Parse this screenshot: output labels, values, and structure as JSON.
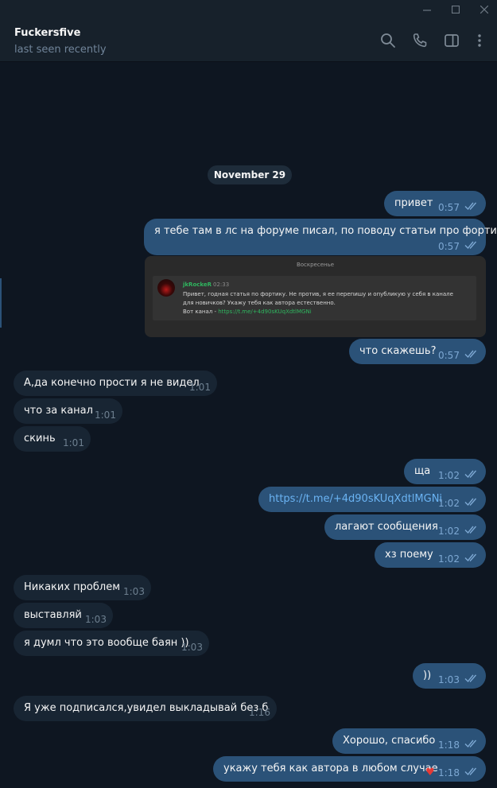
{
  "header": {
    "name": "Fuckersfive",
    "status": "last seen recently"
  },
  "date": "November 29",
  "screenshot": {
    "day": "Воскресенье",
    "author": "jkRockeR",
    "time": "02:33",
    "line1": "Привет, годная статья по фортику. Не против, я ее перепишу и опубликую у себя в канале",
    "line2": "для новичков? Укажу тебя как автора естественно.",
    "line3_prefix": "Вот канал - ",
    "line3_link": "https://t.me/+4d90sKUqXdtlMGNi"
  },
  "messages": [
    {
      "dir": "out",
      "text": "привет",
      "time": "0:57"
    },
    {
      "dir": "out",
      "text": "я тебе там в лс на форуме писал, по поводу статьи про фортик",
      "time": "0:57"
    },
    {
      "dir": "out",
      "text": "что скажешь?",
      "time": "0:57"
    },
    {
      "dir": "in",
      "text": "А,да конечно прости я не видел",
      "time": "1:01"
    },
    {
      "dir": "in",
      "text": "что за канал",
      "time": "1:01"
    },
    {
      "dir": "in",
      "text": "скинь",
      "time": "1:01"
    },
    {
      "dir": "out",
      "text": "ща",
      "time": "1:02"
    },
    {
      "dir": "out",
      "text": "https://t.me/+4d90sKUqXdtlMGNi",
      "time": "1:02"
    },
    {
      "dir": "out",
      "text": "лагают сообщения",
      "time": "1:02"
    },
    {
      "dir": "out",
      "text": "хз поему",
      "time": "1:02"
    },
    {
      "dir": "in",
      "text": "Никаких проблем",
      "time": "1:03"
    },
    {
      "dir": "in",
      "text": "выставляй",
      "time": "1:03"
    },
    {
      "dir": "in",
      "text": "я думл что это вообще баян ))",
      "time": "1:03"
    },
    {
      "dir": "out",
      "text": "))",
      "time": "1:03"
    },
    {
      "dir": "in",
      "text": "Я уже подписался,увидел выкладывай без б",
      "time": "1:16"
    },
    {
      "dir": "out",
      "text": "Хорошо, спасибо",
      "time": "1:18"
    },
    {
      "dir": "out",
      "text": "укажу тебя как автора в любом случае",
      "time": "1:18"
    }
  ],
  "icons": [
    "minimize-icon",
    "maximize-icon",
    "close-icon",
    "search-icon",
    "phone-icon",
    "sidebar-toggle-icon",
    "more-vertical-icon",
    "double-check-icon",
    "heart-reaction-icon"
  ],
  "colors": {
    "background": "#0e1621",
    "outgoing": "#2b5278",
    "incoming": "#182533",
    "header": "#17212b",
    "link": "#6ab3f3"
  }
}
